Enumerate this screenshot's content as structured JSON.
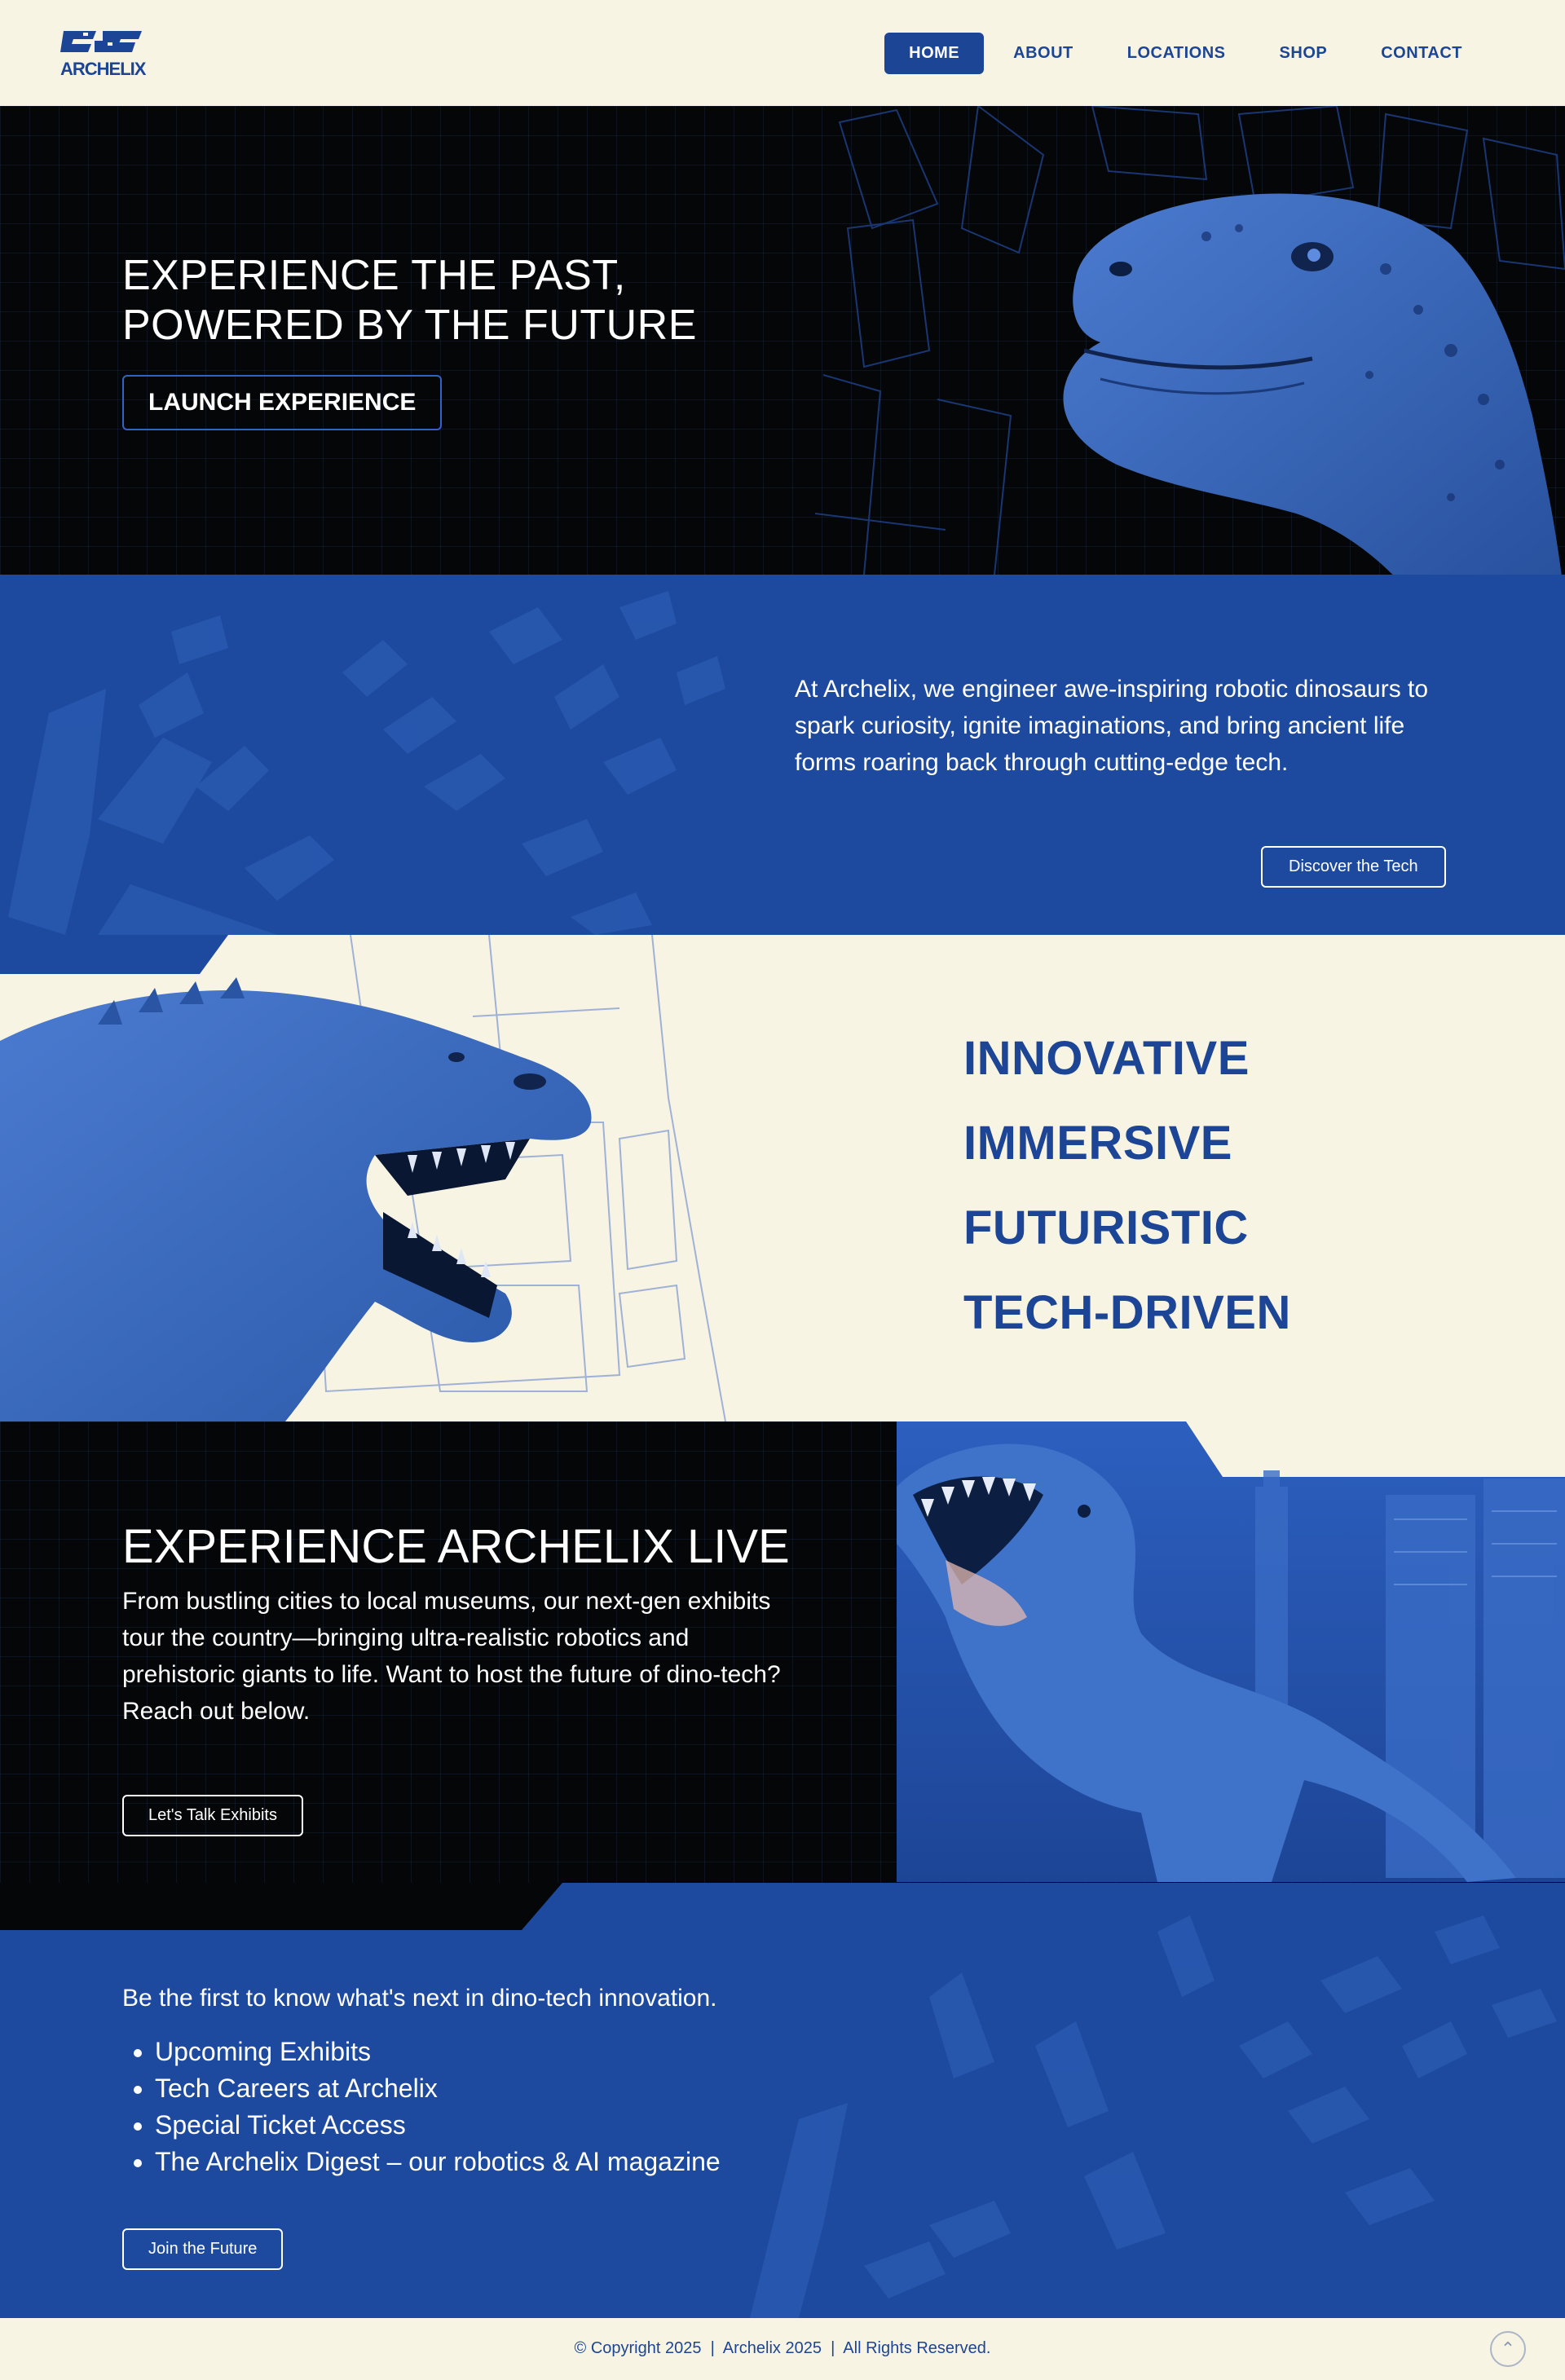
{
  "header": {
    "logo_text": "ARCHELIX",
    "nav": [
      {
        "label": "HOME",
        "active": true
      },
      {
        "label": "ABOUT"
      },
      {
        "label": "LOCATIONS"
      },
      {
        "label": "SHOP"
      },
      {
        "label": "CONTACT"
      }
    ]
  },
  "hero": {
    "title_line1": "EXPERIENCE THE PAST,",
    "title_line2": "POWERED BY THE FUTURE",
    "cta": "LAUNCH EXPERIENCE",
    "image": "raptor-head-illustration"
  },
  "about": {
    "text": "At Archelix, we engineer awe-inspiring robotic dinosaurs to spark curiosity, ignite imaginations, and bring ancient life forms roaring back through cutting-edge tech.",
    "cta": "Discover the Tech"
  },
  "features": {
    "items": [
      "INNOVATIVE",
      "IMMERSIVE",
      "FUTURISTIC",
      "TECH-DRIVEN"
    ],
    "image": "trex-roaring-illustration"
  },
  "live": {
    "title": "EXPERIENCE ARCHELIX LIVE",
    "text": "From bustling cities to local museums, our next-gen exhibits tour the country—bringing ultra-realistic robotics and prehistoric giants to life. Want to host the future of dino-tech? Reach out below.",
    "cta": "Let's Talk Exhibits",
    "image": "trex-city-illustration"
  },
  "news": {
    "intro": "Be the first to know what's next in dino-tech innovation.",
    "items": [
      "Upcoming Exhibits",
      "Tech Careers at Archelix",
      "Special Ticket Access",
      "The Archelix Digest – our robotics & AI magazine"
    ],
    "cta": "Join the Future"
  },
  "footer": {
    "copyright": "© Copyright 2025  |  Archelix 2025  |  All Rights Reserved."
  },
  "colors": {
    "brand_blue": "#1d4596",
    "section_blue": "#1d4a9e",
    "cream": "#f8f4e3",
    "dark": "#050607",
    "dino_blue": "#3b6ac0"
  }
}
